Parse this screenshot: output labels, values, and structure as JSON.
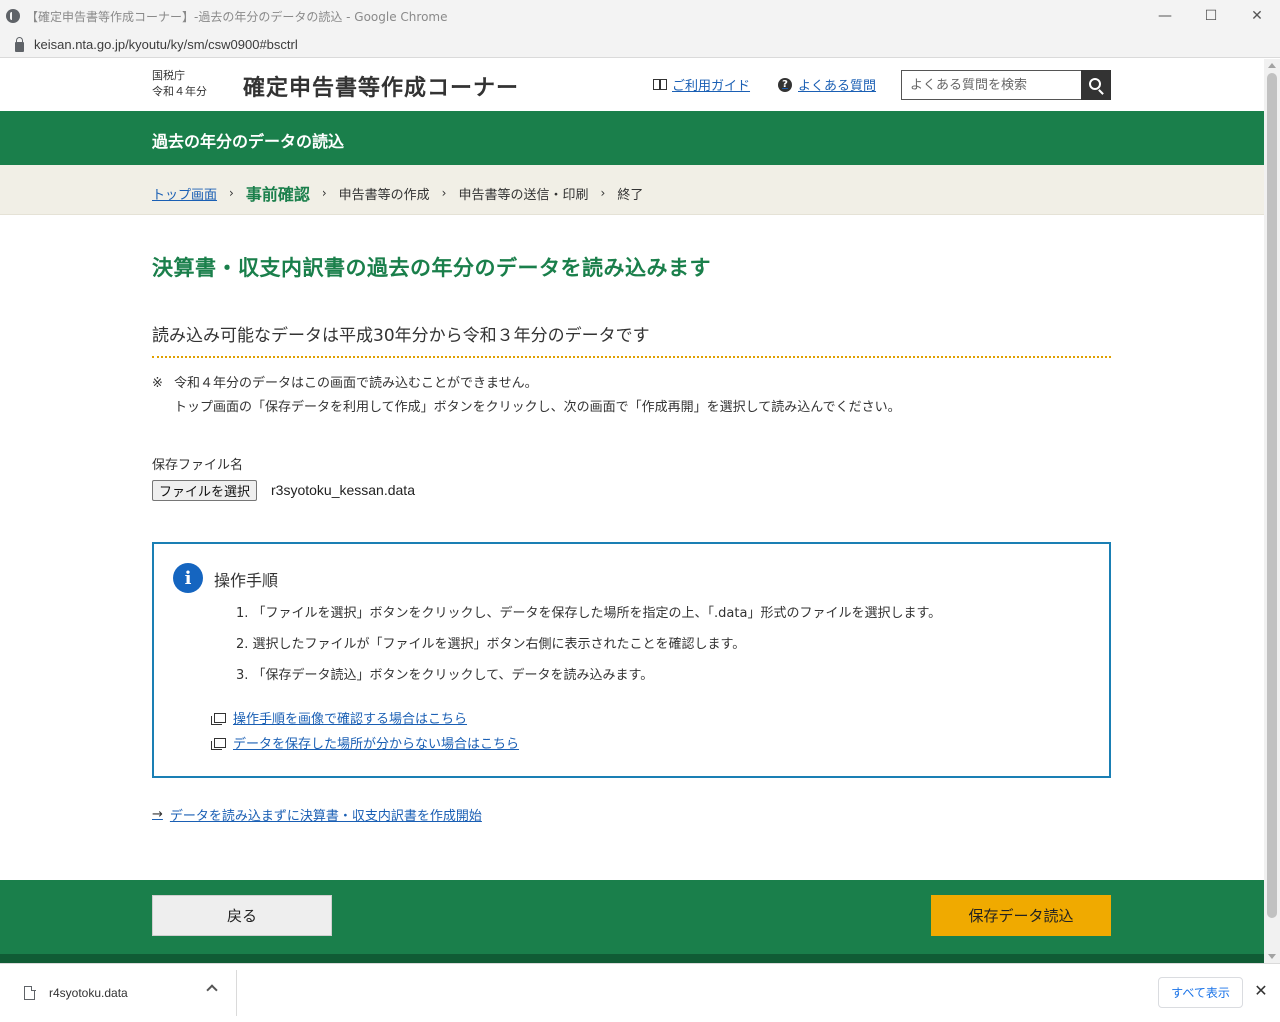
{
  "browser": {
    "window_title": "【確定申告書等作成コーナー】-過去の年分のデータの読込 - Google Chrome",
    "url": "keisan.nta.go.jp/kyoutu/ky/sm/csw0900#bsctrl",
    "minimize_glyph": "—",
    "maximize_glyph": "☐",
    "close_glyph": "✕"
  },
  "header": {
    "agency": "国税庁",
    "tax_year": "令和４年分",
    "site_title": "確定申告書等作成コーナー",
    "guide_link": "ご利用ガイド",
    "faq_link": "よくある質問",
    "search_placeholder": "よくある質問を検索"
  },
  "band": {
    "title": "過去の年分のデータの読込"
  },
  "breadcrumb": {
    "items": [
      "トップ画面",
      "事前確認",
      "申告書等の作成",
      "申告書等の送信・印刷",
      "終了"
    ],
    "separator": "›"
  },
  "main": {
    "heading": "決算書・収支内訳書の過去の年分のデータを読み込みます",
    "subheading": "読み込み可能なデータは平成30年分から令和３年分のデータです",
    "note_mark": "※",
    "note_line1": "令和４年分のデータはこの画面で読み込むことができません。",
    "note_line2": "トップ画面の「保存データを利用して作成」ボタンをクリックし、次の画面で「作成再開」を選択して読み込んでください。",
    "file_label": "保存ファイル名",
    "file_button": "ファイルを選択",
    "file_name": "r3syotoku_kessan.data"
  },
  "info_box": {
    "title": "操作手順",
    "steps": [
      "1. 「ファイルを選択」ボタンをクリックし、データを保存した場所を指定の上、「.data」形式のファイルを選択します。",
      "2. 選択したファイルが「ファイルを選択」ボタン右側に表示されたことを確認します。",
      "3. 「保存データ読込」ボタンをクリックして、データを読み込みます。"
    ],
    "link1": "操作手順を画像で確認する場合はこちら",
    "link2": "データを保存した場所が分からない場合はこちら"
  },
  "start_link": "データを読み込まずに決算書・収支内訳書を作成開始",
  "footer": {
    "back_button": "戻る",
    "load_button": "保存データ読込"
  },
  "downloads": {
    "file": "r4syotoku.data",
    "show_all": "すべて表示"
  },
  "colors": {
    "brand_green": "#1a7f4b",
    "accent_orange": "#f0aa00",
    "link_blue": "#1a5fb4",
    "info_blue": "#1565c0"
  }
}
